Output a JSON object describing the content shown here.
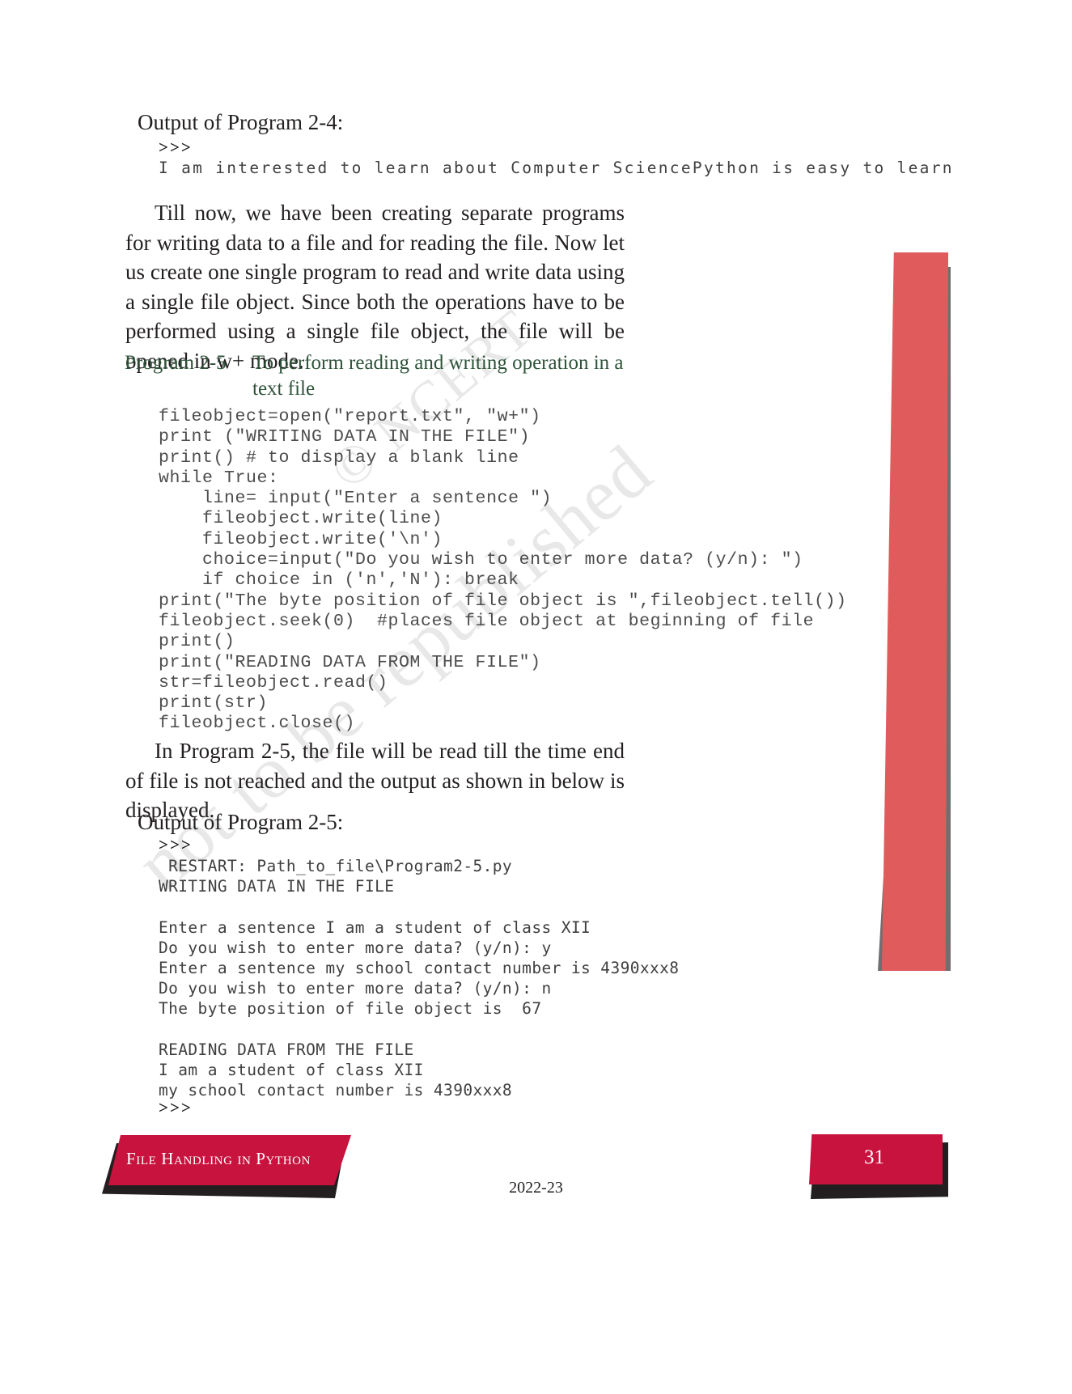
{
  "page": {
    "number": "31",
    "year": "2022-23",
    "footer_chapter": "File Handling in Python",
    "accent_crimson": "#c8133e",
    "accent_green": "#2e5339",
    "accent_red_bar": "#e05c5c",
    "accent_gray_bar": "#6f6f6f"
  },
  "watermark": {
    "line1": "© NCERT",
    "line2": "not to be republished"
  },
  "output_2_4": {
    "heading": "Output of Program 2-4:",
    "prompt": ">>>",
    "lines": [
      "I am interested to learn about Computer SciencePython is easy to learn"
    ]
  },
  "paragraph_1": "Till now, we have been creating separate programs for writing data to a file and for reading the file. Now let us create one single program to read and write data using a single file object. Since both the operations have to be performed using a single file object, the file will be opened in w+ mode.",
  "program_2_5": {
    "label": "Program 2-5",
    "title": "To perform reading and writing operation in a text file",
    "code": "fileobject=open(\"report.txt\", \"w+\")\nprint (\"WRITING DATA IN THE FILE\")\nprint() # to display a blank line\nwhile True:\n    line= input(\"Enter a sentence \")\n    fileobject.write(line)\n    fileobject.write('\\n')\n    choice=input(\"Do you wish to enter more data? (y/n): \")\n    if choice in ('n','N'): break\nprint(\"The byte position of file object is \",fileobject.tell())\nfileobject.seek(0)  #places file object at beginning of file\nprint()\nprint(\"READING DATA FROM THE FILE\")\nstr=fileobject.read()\nprint(str)\nfileobject.close()"
  },
  "paragraph_2": "In Program 2-5, the file will be read till the time end of file is not reached and the output as shown in below is displayed.",
  "output_2_5": {
    "heading": "Output of Program 2-5:",
    "prompt_top": ">>>",
    "body": " RESTART: Path_to_file\\Program2-5.py\nWRITING DATA IN THE FILE\n\nEnter a sentence I am a student of class XII\nDo you wish to enter more data? (y/n): y\nEnter a sentence my school contact number is 4390xxx8\nDo you wish to enter more data? (y/n): n\nThe byte position of file object is  67\n\nREADING DATA FROM THE FILE\nI am a student of class XII\nmy school contact number is 4390xxx8",
    "prompt_bottom": ">>>"
  }
}
